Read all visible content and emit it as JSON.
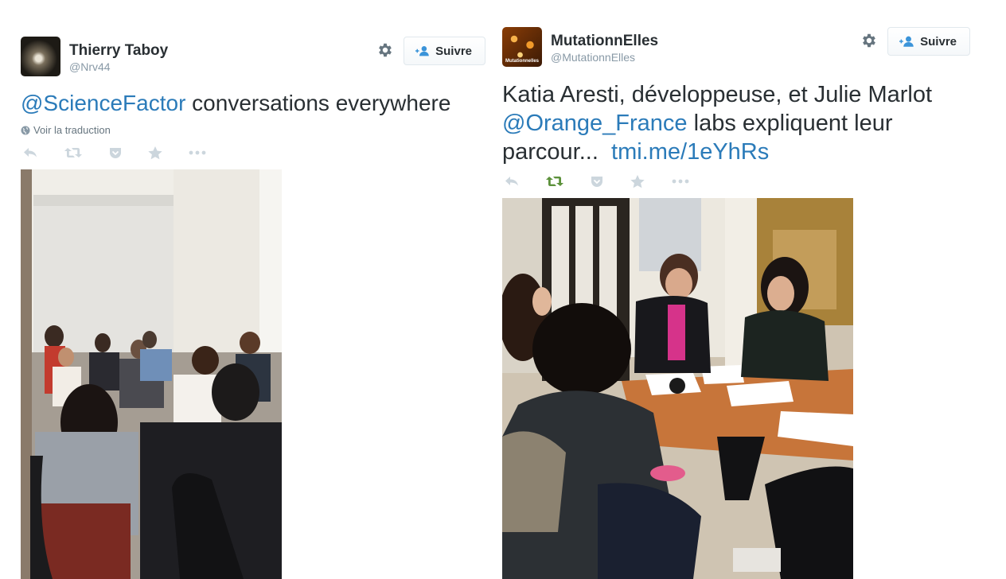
{
  "tweets": [
    {
      "display_name": "Thierry Taboy",
      "handle": "@Nrv44",
      "follow_label": "Suivre",
      "mention": "@ScienceFactor",
      "text": " conversations everywhere",
      "translate_label": "Voir la traduction"
    },
    {
      "display_name": "MutationnElles",
      "handle": "@MutationnElles",
      "avatar_caption": "Mutationnelles",
      "follow_label": "Suivre",
      "text_line1": "Katia Aresti, développeuse, et Julie Marlot",
      "mention": "@Orange_France",
      "text_line2": " labs expliquent leur",
      "text_line3": "parcour...  ",
      "link": "tmi.me/1eYhRs"
    }
  ],
  "colors": {
    "link": "#2b7bb9",
    "action_idle": "#ccd6dd",
    "retweet_active": "#5c913b",
    "muted_text": "#8899a6"
  },
  "icons": [
    "gear-icon",
    "follow-person-icon",
    "globe-icon",
    "reply-icon",
    "retweet-icon",
    "pocket-icon",
    "favorite-star-icon",
    "more-dots-icon"
  ]
}
